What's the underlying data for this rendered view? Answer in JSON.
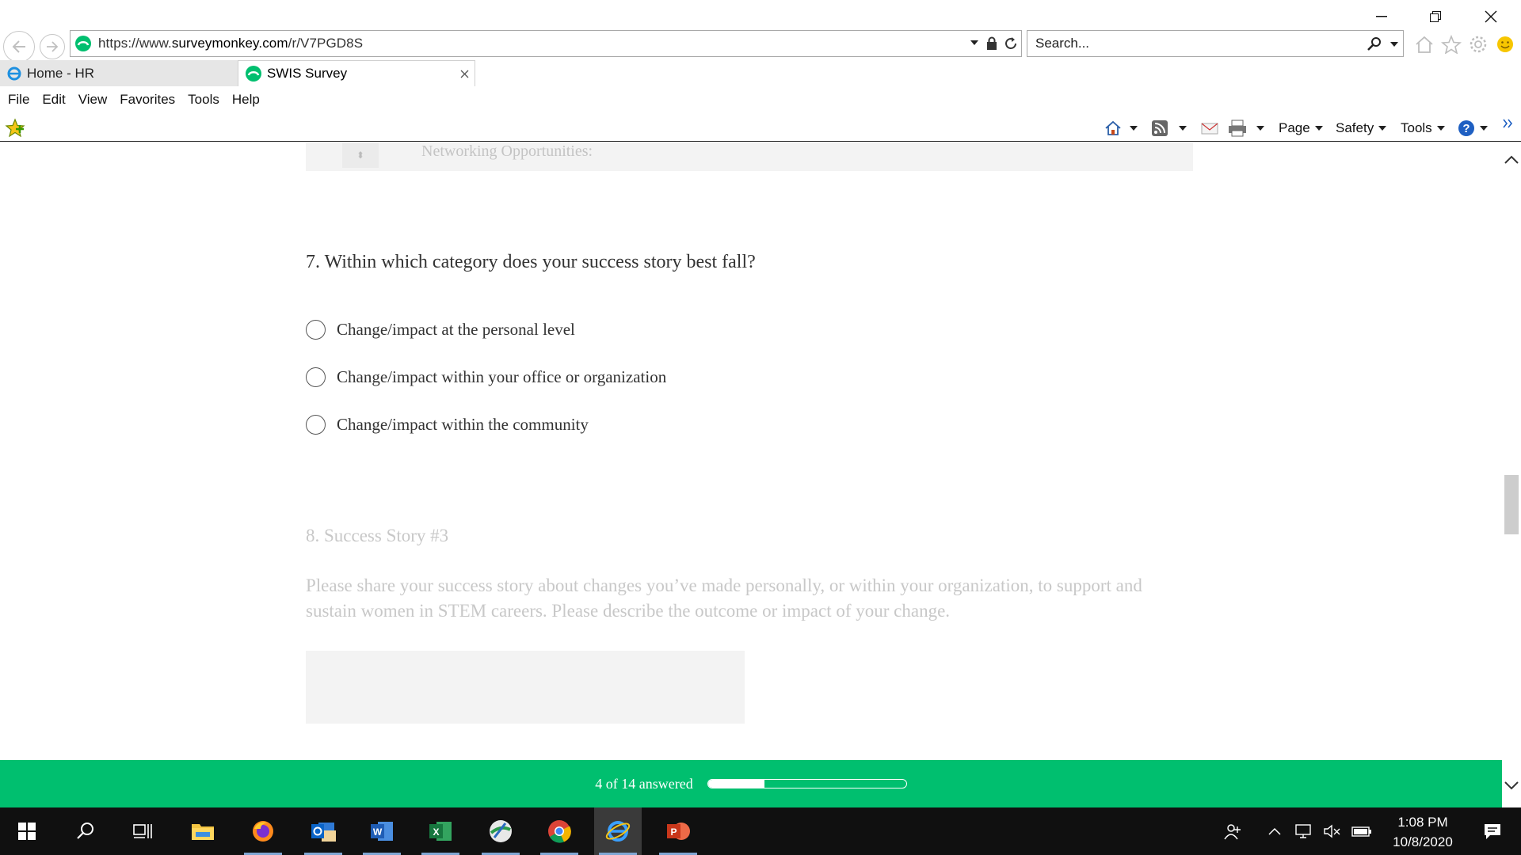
{
  "browser": {
    "url_prefix": "https://www.",
    "url_domain": "surveymonkey.com",
    "url_path": "/r/V7PGD8S",
    "search_placeholder": "Search...",
    "tabs": [
      {
        "label": "Home - HR"
      },
      {
        "label": "SWIS Survey"
      }
    ],
    "menu": [
      "File",
      "Edit",
      "View",
      "Favorites",
      "Tools",
      "Help"
    ],
    "commands": {
      "page": "Page",
      "safety": "Safety",
      "tools": "Tools"
    }
  },
  "survey": {
    "previous_item_label": "Networking Opportunities:",
    "question7": {
      "title": "7. Within which category does your success story best fall?",
      "options": [
        "Change/impact at the personal level",
        "Change/impact within your office or organization",
        "Change/impact within the community"
      ]
    },
    "question8": {
      "title": "8. Success Story #3",
      "description": "Please share your success story about changes you’ve made personally, or within your organization, to support and sustain women in STEM careers. Please describe the outcome or impact of your change."
    },
    "progress": {
      "text": "4 of 14 answered",
      "answered": 4,
      "total": 14
    }
  },
  "taskbar": {
    "apps": [
      "start-icon",
      "search-icon",
      "task-view-icon",
      "file-explorer-icon",
      "firefox-icon",
      "outlook-icon",
      "word-icon",
      "excel-icon",
      "network-app-icon",
      "chrome-icon",
      "internet-explorer-icon",
      "powerpoint-icon"
    ],
    "time": "1:08 PM",
    "date": "10/8/2020"
  },
  "colors": {
    "surveymonkey_green": "#00bf6f",
    "taskbar": "#101010"
  }
}
